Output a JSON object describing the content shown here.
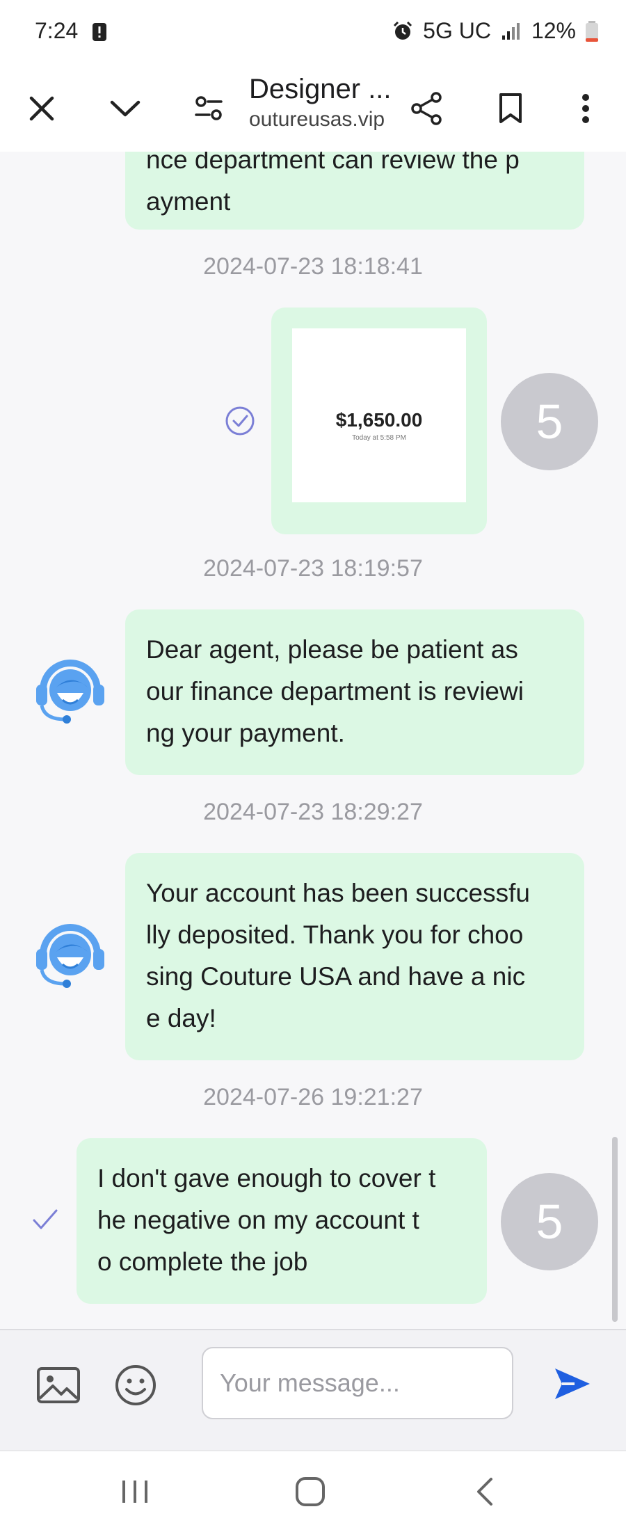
{
  "status": {
    "time": "7:24",
    "network": "5G UC",
    "battery": "12%"
  },
  "browser": {
    "title": "Designer ...",
    "url": "outureusas.vip"
  },
  "messages": {
    "m1": {
      "text_line1": "nce department can review the p",
      "text_line2": "ayment"
    },
    "t1": "2024-07-23 18:18:41",
    "m2": {
      "amount": "$1,650.00",
      "caption": "Today at 5:58 PM",
      "avatar": "5"
    },
    "t2": "2024-07-23 18:19:57",
    "m3": {
      "line1": "Dear agent, please be patient as",
      "line2": "our finance department is reviewi",
      "line3": "ng your payment."
    },
    "t3": "2024-07-23 18:29:27",
    "m4": {
      "line1": "Your account has been successfu",
      "line2": "lly deposited. Thank you for choo",
      "line3": "sing Couture USA and have a nic",
      "line4": "e day!"
    },
    "t4": "2024-07-26 19:21:27",
    "m5": {
      "line1": "I don't gave enough to cover t",
      "line2": "he negative  on my account t",
      "line3": "o complete the job",
      "avatar": "5"
    }
  },
  "input": {
    "placeholder": "Your message..."
  },
  "colors": {
    "bubble": "#dcf8e4",
    "send": "#1f5fe0",
    "agent_icon": "#5aa2f0",
    "avatar": "#c9c9cf"
  },
  "icons": {
    "status": [
      "alarm-icon",
      "signal-icon",
      "battery-icon",
      "alert-icon"
    ],
    "toolbar": [
      "close-icon",
      "chevron-down-icon",
      "page-settings-icon",
      "share-icon",
      "bookmark-icon",
      "more-options-icon"
    ],
    "input": [
      "image-icon",
      "emoji-icon",
      "send-icon"
    ],
    "nav": [
      "recent-apps-icon",
      "home-icon",
      "back-icon"
    ],
    "chat": [
      "agent-avatar-icon",
      "sent-check-icon"
    ]
  }
}
